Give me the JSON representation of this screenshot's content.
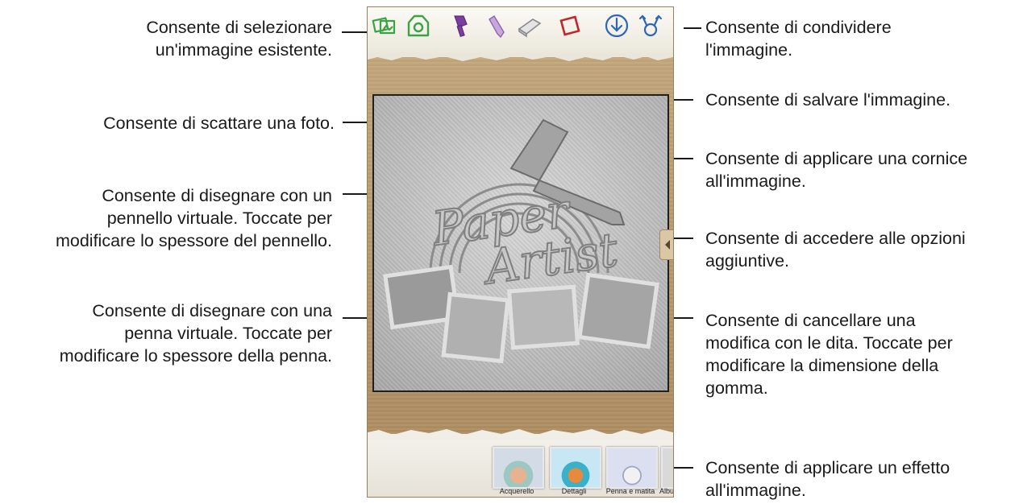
{
  "annotations": {
    "select_image": [
      "Consente di selezionare",
      "un'immagine esistente."
    ],
    "take_photo": [
      "Consente di scattare una foto."
    ],
    "brush": [
      "Consente di disegnare con un",
      "pennello virtuale. Toccate per",
      "modificare lo spessore del pennello."
    ],
    "pen": [
      "Consente di disegnare con una",
      "penna virtuale. Toccate per",
      "modificare lo spessore della penna."
    ],
    "share": [
      "Consente di condividere",
      "l'immagine."
    ],
    "save": [
      "Consente di salvare l'immagine."
    ],
    "frame": [
      "Consente di applicare una cornice",
      "all'immagine."
    ],
    "options": [
      "Consente di accedere alle opzioni",
      "aggiuntive."
    ],
    "eraser": [
      "Consente di cancellare una",
      "modifica con le dita. Toccate per",
      "modificare la dimensione della",
      "gomma."
    ],
    "effect": [
      "Consente di applicare un effetto",
      "all'immagine."
    ]
  },
  "toolbar": {
    "icons": [
      "gallery-icon",
      "camera-icon",
      "brush-icon",
      "pen-icon",
      "eraser-icon",
      "frame-icon",
      "save-icon",
      "share-icon"
    ]
  },
  "canvas": {
    "artwork_text": [
      "Paper",
      "Artist"
    ]
  },
  "effects": [
    {
      "label": "Acquerello"
    },
    {
      "label": "Dettagli"
    },
    {
      "label": "Penna e matita"
    },
    {
      "label": "Albu"
    }
  ],
  "colors": {
    "green": "#3aa346",
    "purple": "#7b3fa0",
    "red": "#c0282c",
    "blue": "#2f65b8"
  }
}
